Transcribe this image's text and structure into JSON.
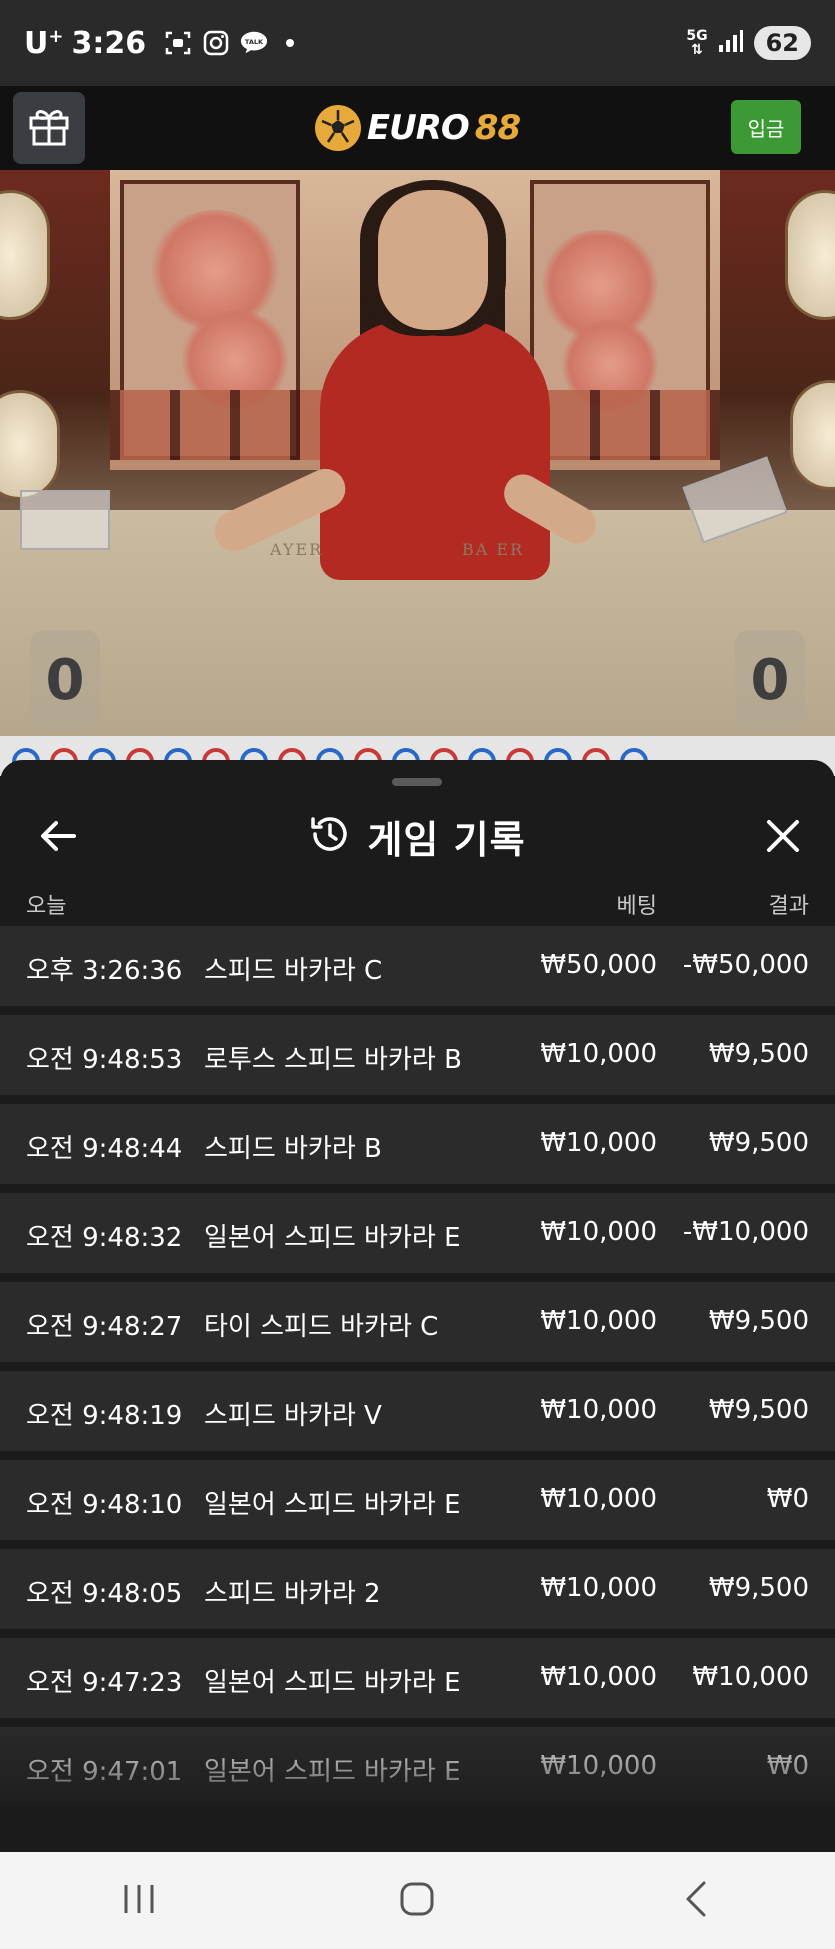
{
  "status_bar": {
    "carrier": "U",
    "carrier_plus": "+",
    "time": "3:26",
    "network_label": "5G",
    "battery": "62"
  },
  "header": {
    "logo_text": "EURO",
    "logo_number": "88",
    "deposit_label": "입금"
  },
  "video": {
    "player_label": "AYER",
    "banker_label": "BA ER",
    "left_score": "0",
    "right_score": "0"
  },
  "history": {
    "title": "게임 기록",
    "col_today": "오늘",
    "col_bet": "베팅",
    "col_result": "결과",
    "rows": [
      {
        "time": "오후 3:26:36",
        "game": "스피드 바카라 C",
        "bet": "₩50,000",
        "result": "-₩50,000"
      },
      {
        "time": "오전 9:48:53",
        "game": "로투스 스피드 바카라 B",
        "bet": "₩10,000",
        "result": "₩9,500"
      },
      {
        "time": "오전 9:48:44",
        "game": "스피드 바카라 B",
        "bet": "₩10,000",
        "result": "₩9,500"
      },
      {
        "time": "오전 9:48:32",
        "game": "일본어 스피드 바카라 E",
        "bet": "₩10,000",
        "result": "-₩10,000"
      },
      {
        "time": "오전 9:48:27",
        "game": "타이 스피드 바카라 C",
        "bet": "₩10,000",
        "result": "₩9,500"
      },
      {
        "time": "오전 9:48:19",
        "game": "스피드 바카라 V",
        "bet": "₩10,000",
        "result": "₩9,500"
      },
      {
        "time": "오전 9:48:10",
        "game": "일본어 스피드 바카라 E",
        "bet": "₩10,000",
        "result": "₩0"
      },
      {
        "time": "오전 9:48:05",
        "game": "스피드 바카라 2",
        "bet": "₩10,000",
        "result": "₩9,500"
      },
      {
        "time": "오전 9:47:23",
        "game": "일본어 스피드 바카라 E",
        "bet": "₩10,000",
        "result": "₩10,000"
      },
      {
        "time": "오전 9:47:01",
        "game": "일본어 스피드 바카라 E",
        "bet": "₩10,000",
        "result": "₩0"
      }
    ]
  },
  "colors": {
    "deposit_green": "#3c9a34",
    "logo_gold": "#e6a93a",
    "row_bg": "#2b2b2b",
    "sheet_bg": "#1b1b1b"
  },
  "icons": {
    "gift": "gift-icon",
    "history": "history-icon",
    "back": "arrow-left-icon",
    "close": "close-icon",
    "nav_recent": "recent-apps-icon",
    "nav_home": "home-icon",
    "nav_back": "back-icon"
  }
}
